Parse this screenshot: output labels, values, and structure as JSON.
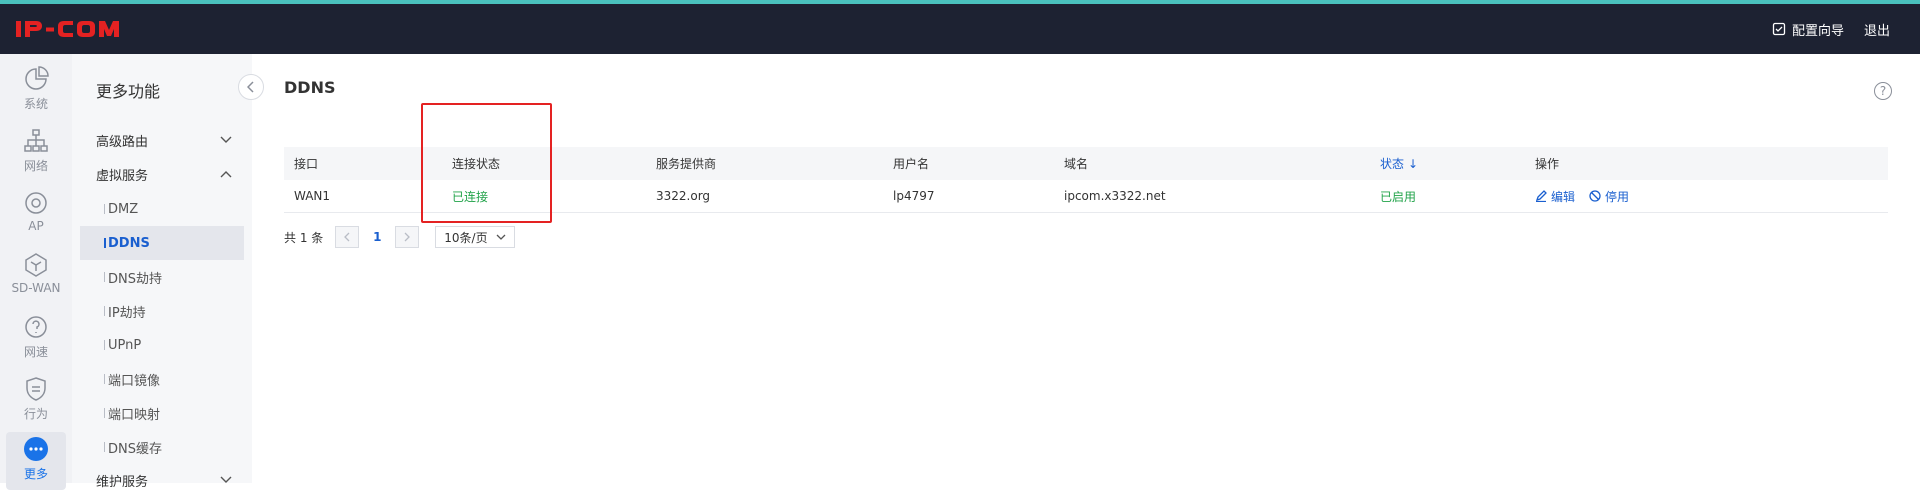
{
  "app": {
    "brand": "IP-COM"
  },
  "header": {
    "wizard_label": "配置向导",
    "logout_label": "退出"
  },
  "iconbar": {
    "items": [
      {
        "label": "系统",
        "icon": "pie-chart-icon"
      },
      {
        "label": "网络",
        "icon": "network-tree-icon"
      },
      {
        "label": "AP",
        "icon": "ap-icon"
      },
      {
        "label": "SD-WAN",
        "icon": "sdwan-icon"
      },
      {
        "label": "网速",
        "icon": "speed-icon"
      },
      {
        "label": "行为",
        "icon": "behavior-icon"
      },
      {
        "label": "更多",
        "icon": "more-icon",
        "active": true
      }
    ]
  },
  "submenu": {
    "title": "更多功能",
    "groups": [
      {
        "label": "高级路由",
        "expanded": false
      },
      {
        "label": "虚拟服务",
        "expanded": true
      },
      {
        "label": "维护服务",
        "expanded": false
      }
    ],
    "items": [
      {
        "label": "DMZ"
      },
      {
        "label": "DDNS",
        "active": true
      },
      {
        "label": "DNS劫持"
      },
      {
        "label": "IP劫持"
      },
      {
        "label": "UPnP"
      },
      {
        "label": "端口镜像"
      },
      {
        "label": "端口映射"
      },
      {
        "label": "DNS缓存"
      }
    ]
  },
  "main": {
    "title": "DDNS",
    "help": "?",
    "table": {
      "headers": [
        "接口",
        "连接状态",
        "服务提供商",
        "用户名",
        "域名",
        "状态",
        "操作"
      ],
      "sort_indicator": "↓",
      "rows": [
        {
          "interface": "WAN1",
          "connection": "已连接",
          "provider": "3322.org",
          "username": "lp4797",
          "domain": "ipcom.x3322.net",
          "status": "已启用",
          "edit": "编辑",
          "disable": "停用"
        }
      ]
    },
    "pager": {
      "total": "共 1 条",
      "page": "1",
      "page_size": "10条/页"
    }
  },
  "colors": {
    "accent": "#1a5fcf",
    "green": "#22a34a",
    "topbar": "#1d2232",
    "stripe": "#4ac1bd",
    "highlight": "#e42222"
  }
}
